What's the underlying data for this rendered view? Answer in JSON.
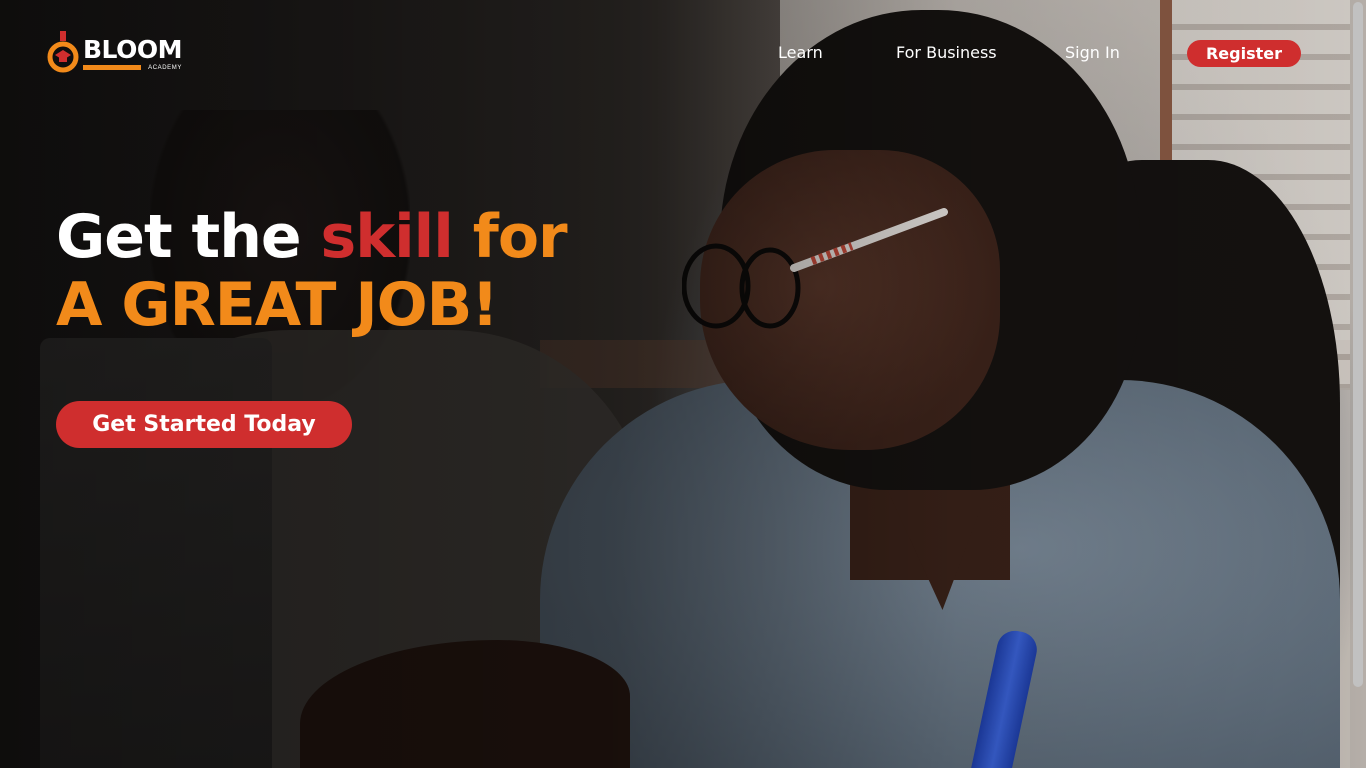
{
  "brand": {
    "name": "BLOOM",
    "tagline": "ACADEMY",
    "colors": {
      "orange": "#f28a1a",
      "red": "#cf2e2e",
      "white": "#ffffff"
    }
  },
  "nav": {
    "learn": "Learn",
    "for_business": "For Business",
    "sign_in": "Sign In",
    "register": "Register"
  },
  "hero": {
    "line1_part1": "Get the ",
    "line1_part2": "skill",
    "line1_part3": " for",
    "line2": "A GREAT JOB!",
    "cta_label": "Get Started Today"
  },
  "icons": {
    "logo": "graduation-cap-icon",
    "learn_dropdown": "chevron-down-icon"
  }
}
